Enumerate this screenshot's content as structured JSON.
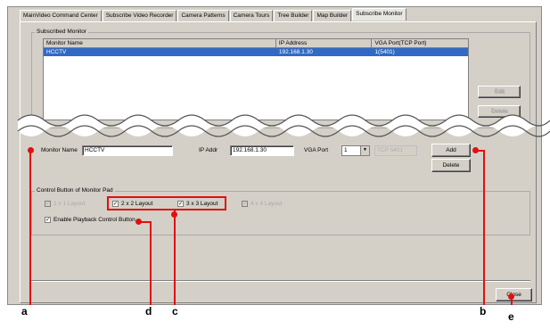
{
  "tabs": [
    {
      "label": "MainVideo Command Center"
    },
    {
      "label": "Subscribe Video Recorder"
    },
    {
      "label": "Camera Patterns"
    },
    {
      "label": "Camera Tours"
    },
    {
      "label": "Tree Builder"
    },
    {
      "label": "Map Builder"
    },
    {
      "label": "Subscribe Monitor",
      "active": true
    }
  ],
  "subscribed_group": {
    "title": "Subscribed Monitor",
    "columns": [
      "Monitor Name",
      "IP Address",
      "VGA Port(TCP Port)"
    ],
    "rows": [
      {
        "name": "HCCTV",
        "ip": "192.168.1.30",
        "port": "1(5401)"
      }
    ],
    "side_buttons": [
      "Edit",
      "Delete"
    ]
  },
  "form": {
    "monitor_name_label": "Monitor Name",
    "monitor_name_value": "HCCTV",
    "ip_label": "IP Addr",
    "ip_value": "192.168.1.30",
    "vga_label": "VGA Port",
    "vga_value": "1",
    "tcp_value": "TCP 5401",
    "add_label": "Add",
    "delete_label": "Delete"
  },
  "control_group": {
    "title": "Control Button of Monitor Pad",
    "options": [
      {
        "label": "1 x 1 Layout",
        "checked": true,
        "enabled": false
      },
      {
        "label": "2 x 2 Layout",
        "checked": true,
        "enabled": true
      },
      {
        "label": "3 x 3 Layout",
        "checked": true,
        "enabled": true
      },
      {
        "label": "4 x 4 Layout",
        "checked": true,
        "enabled": false
      }
    ],
    "playback_label": "Enable Playback Control Button",
    "playback_checked": true
  },
  "close_label": "Close",
  "check_glyph": "✓",
  "dropdown_glyph": "▼",
  "callouts": [
    "a",
    "b",
    "c",
    "d",
    "e"
  ],
  "colors": {
    "callout": "#e01010",
    "selection": "#316ac5",
    "window": "#d4d0c8"
  }
}
